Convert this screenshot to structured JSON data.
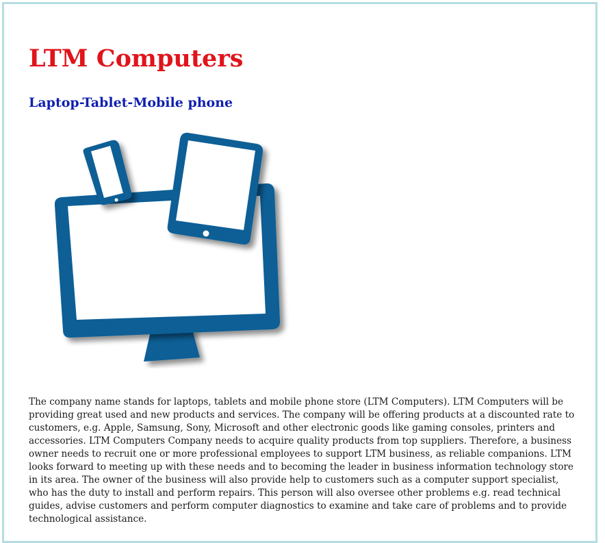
{
  "header": {
    "title": "LTM Computers",
    "subtitle": "Laptop-Tablet-Mobile phone"
  },
  "illustration": {
    "icon": "devices-icon",
    "color": "#0c5f96"
  },
  "content": {
    "paragraph": "The company name stands for laptops, tablets and mobile phone store (LTM Computers). LTM Computers will be providing great used and new products and services. The company will be offering products at a discounted rate to customers, e.g. Apple, Samsung, Sony, Microsoft and other electronic goods like gaming consoles, printers and accessories. LTM Computers Company needs to acquire quality products from top suppliers. Therefore, a business owner needs to recruit one or more professional employees to support LTM business, as reliable companions. LTM looks forward to meeting up with these needs and to becoming the leader in business information technology store in its area. The owner of the business will also provide help to customers such as a computer support specialist, who has the duty to install and perform repairs. This person will also oversee other problems e.g. read technical guides, advise customers and perform computer diagnostics to examine and take care of problems and to provide technological assistance."
  },
  "theme": {
    "title_color": "#e0141b",
    "subtitle_color": "#0f1fb0",
    "border_color": "#b4dde1"
  }
}
